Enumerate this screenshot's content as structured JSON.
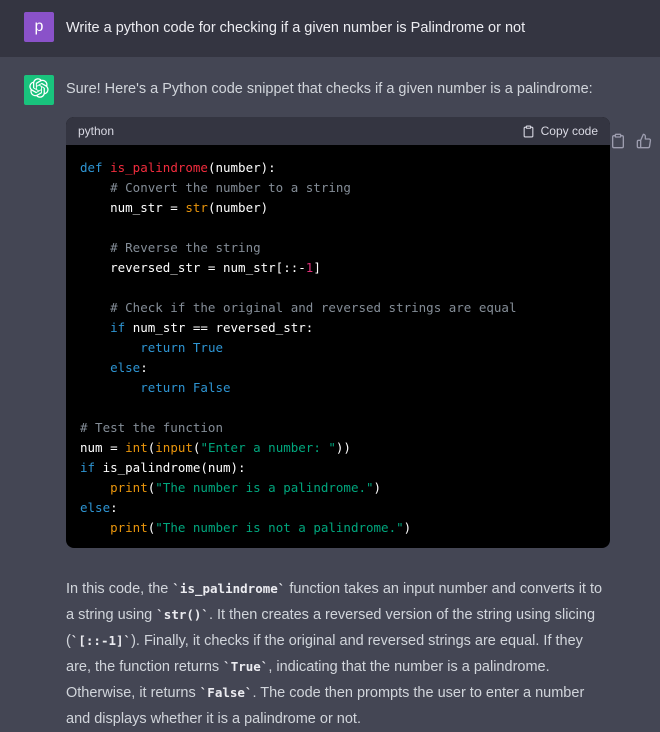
{
  "colors": {
    "user_row_bg": "#343541",
    "assistant_row_bg": "#444654",
    "user_avatar_bg": "#8a52c9",
    "bot_avatar_bg": "#19c37d",
    "code_bg": "#000000",
    "code_header_bg": "#343541",
    "token_keyword": "#2e95d3",
    "token_function": "#f22c3d",
    "token_builtin": "#e9950c",
    "token_string": "#00a67d",
    "token_number": "#df3079",
    "token_comment": "#848d97"
  },
  "user_message": {
    "avatar_letter": "p",
    "text": "Write a python code for checking if a given number is Palindrome or not"
  },
  "assistant_message": {
    "intro": "Sure! Here's a Python code snippet that checks if a given number is a palindrome:",
    "code_block": {
      "language": "python",
      "copy_label": "Copy code",
      "lines": [
        [
          {
            "t": "def ",
            "c": "kw"
          },
          {
            "t": "is_palindrome",
            "c": "fn"
          },
          {
            "t": "(number):",
            "c": "pl"
          }
        ],
        [
          {
            "t": "    # Convert the number to a string",
            "c": "cm"
          }
        ],
        [
          {
            "t": "    num_str = ",
            "c": "pl"
          },
          {
            "t": "str",
            "c": "bi"
          },
          {
            "t": "(number)",
            "c": "pl"
          }
        ],
        [],
        [
          {
            "t": "    # Reverse the string",
            "c": "cm"
          }
        ],
        [
          {
            "t": "    reversed_str = num_str[::-",
            "c": "pl"
          },
          {
            "t": "1",
            "c": "nu"
          },
          {
            "t": "]",
            "c": "pl"
          }
        ],
        [],
        [
          {
            "t": "    # Check if the original and reversed strings are equal",
            "c": "cm"
          }
        ],
        [
          {
            "t": "    ",
            "c": "pl"
          },
          {
            "t": "if ",
            "c": "kw"
          },
          {
            "t": "num_str == reversed_str:",
            "c": "pl"
          }
        ],
        [
          {
            "t": "        ",
            "c": "pl"
          },
          {
            "t": "return True",
            "c": "kw"
          }
        ],
        [
          {
            "t": "    ",
            "c": "pl"
          },
          {
            "t": "else",
            "c": "kw"
          },
          {
            "t": ":",
            "c": "pl"
          }
        ],
        [
          {
            "t": "        ",
            "c": "pl"
          },
          {
            "t": "return False",
            "c": "kw"
          }
        ],
        [],
        [
          {
            "t": "# Test the function",
            "c": "cm"
          }
        ],
        [
          {
            "t": "num = ",
            "c": "pl"
          },
          {
            "t": "int",
            "c": "bi"
          },
          {
            "t": "(",
            "c": "pl"
          },
          {
            "t": "input",
            "c": "bi"
          },
          {
            "t": "(",
            "c": "pl"
          },
          {
            "t": "\"Enter a number: \"",
            "c": "st"
          },
          {
            "t": "))",
            "c": "pl"
          }
        ],
        [
          {
            "t": "if ",
            "c": "kw"
          },
          {
            "t": "is_palindrome(num):",
            "c": "pl"
          }
        ],
        [
          {
            "t": "    ",
            "c": "pl"
          },
          {
            "t": "print",
            "c": "bi"
          },
          {
            "t": "(",
            "c": "pl"
          },
          {
            "t": "\"The number is a palindrome.\"",
            "c": "st"
          },
          {
            "t": ")",
            "c": "pl"
          }
        ],
        [
          {
            "t": "else",
            "c": "kw"
          },
          {
            "t": ":",
            "c": "pl"
          }
        ],
        [
          {
            "t": "    ",
            "c": "pl"
          },
          {
            "t": "print",
            "c": "bi"
          },
          {
            "t": "(",
            "c": "pl"
          },
          {
            "t": "\"The number is not a palindrome.\"",
            "c": "st"
          },
          {
            "t": ")",
            "c": "pl"
          }
        ]
      ]
    },
    "explanation_segments": [
      {
        "text": "In this code, the ",
        "code": false
      },
      {
        "text": "`is_palindrome`",
        "code": true
      },
      {
        "text": " function takes an input number and converts it to a string using ",
        "code": false
      },
      {
        "text": "`str()`",
        "code": true
      },
      {
        "text": ". It then creates a reversed version of the string using slicing (",
        "code": false
      },
      {
        "text": "`[::-1]`",
        "code": true
      },
      {
        "text": "). Finally, it checks if the original and reversed strings are equal. If they are, the function returns ",
        "code": false
      },
      {
        "text": "`True`",
        "code": true
      },
      {
        "text": ", indicating that the number is a palindrome. Otherwise, it returns ",
        "code": false
      },
      {
        "text": "`False`",
        "code": true
      },
      {
        "text": ". The code then prompts the user to enter a number and displays whether it is a palindrome or not.",
        "code": false
      }
    ]
  }
}
